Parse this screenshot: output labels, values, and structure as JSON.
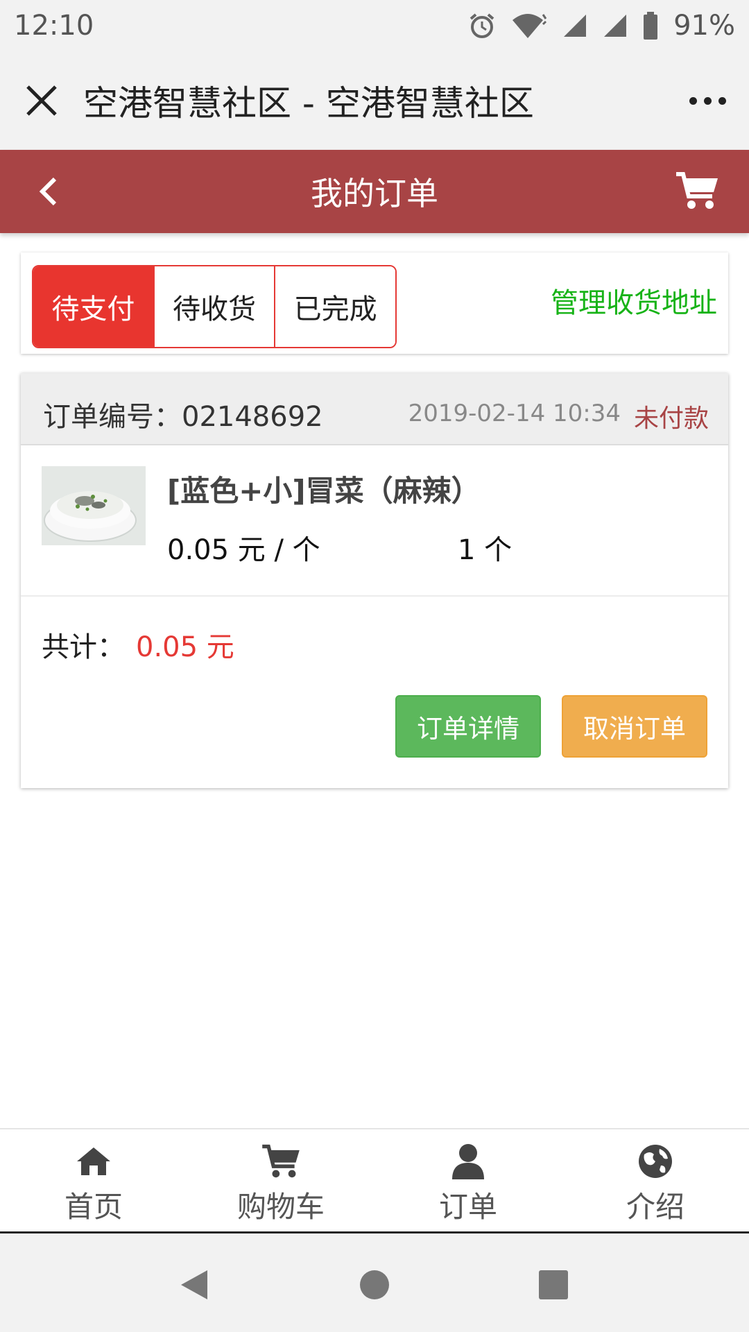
{
  "status_bar": {
    "time": "12:10",
    "battery": "91%",
    "icons": [
      "alarm-icon",
      "wifi-icon",
      "signal-icon",
      "signal-icon",
      "battery-icon"
    ]
  },
  "titlebar": {
    "title": "空港智慧社区 - 空港智慧社区",
    "close_icon": "close-icon",
    "more_icon": "more-icon"
  },
  "header": {
    "title": "我的订单",
    "back_icon": "chevron-left-icon",
    "cart_icon": "cart-icon",
    "color": "#a84445"
  },
  "tabs": {
    "items": [
      {
        "label": "待支付",
        "active": true
      },
      {
        "label": "待收货",
        "active": false
      },
      {
        "label": "已完成",
        "active": false
      }
    ],
    "manage_link": "管理收货地址",
    "active_color": "#e8352f",
    "link_color": "#17b317"
  },
  "order": {
    "number_label": "订单编号：",
    "number": "02148692",
    "time": "2019-02-14 10:34",
    "status": "未付款",
    "item": {
      "name": "[蓝色+小]冒菜（麻辣）",
      "price": "0.05 元 / 个",
      "quantity": "1 个"
    },
    "total_label": "共计：",
    "total_value": "0.05 元",
    "detail_button": "订单详情",
    "cancel_button": "取消订单"
  },
  "bottom_nav": [
    {
      "label": "首页",
      "icon": "home-icon"
    },
    {
      "label": "购物车",
      "icon": "cart-icon"
    },
    {
      "label": "订单",
      "icon": "user-icon"
    },
    {
      "label": "介绍",
      "icon": "globe-icon"
    }
  ],
  "system_nav": {
    "icons": [
      "back-triangle-icon",
      "home-circle-icon",
      "recents-square-icon"
    ]
  }
}
